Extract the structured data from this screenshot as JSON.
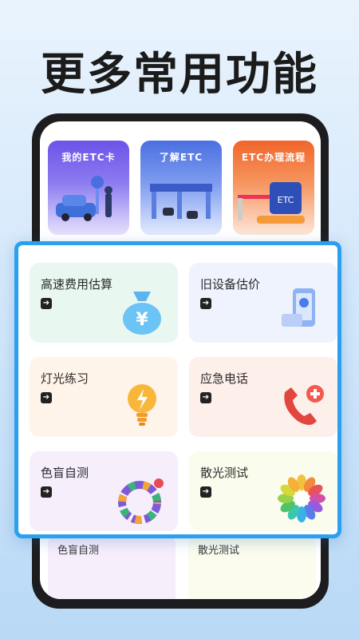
{
  "headline": "更多常用功能",
  "banners": [
    {
      "label": "我的ETC卡"
    },
    {
      "label": "了解ETC"
    },
    {
      "label": "ETC办理流程"
    }
  ],
  "banner_art": {
    "sign_text": "ETC"
  },
  "features": [
    {
      "label": "高速费用估算",
      "icon": "money-bag-icon"
    },
    {
      "label": "旧设备估价",
      "icon": "phone-device-icon"
    },
    {
      "label": "灯光练习",
      "icon": "light-bulb-icon"
    },
    {
      "label": "应急电话",
      "icon": "phone-handset-icon"
    },
    {
      "label": "色盲自测",
      "icon": "color-wheel-icon"
    },
    {
      "label": "散光测试",
      "icon": "flower-dial-icon"
    }
  ],
  "ghost_row": [
    {
      "label": "色盲自测"
    },
    {
      "label": "散光测试"
    }
  ],
  "arrow_glyph": "➔",
  "money_glyph": "¥",
  "colors": {
    "highlight_border": "#2aa0f0",
    "headline": "#1b1b1b"
  }
}
